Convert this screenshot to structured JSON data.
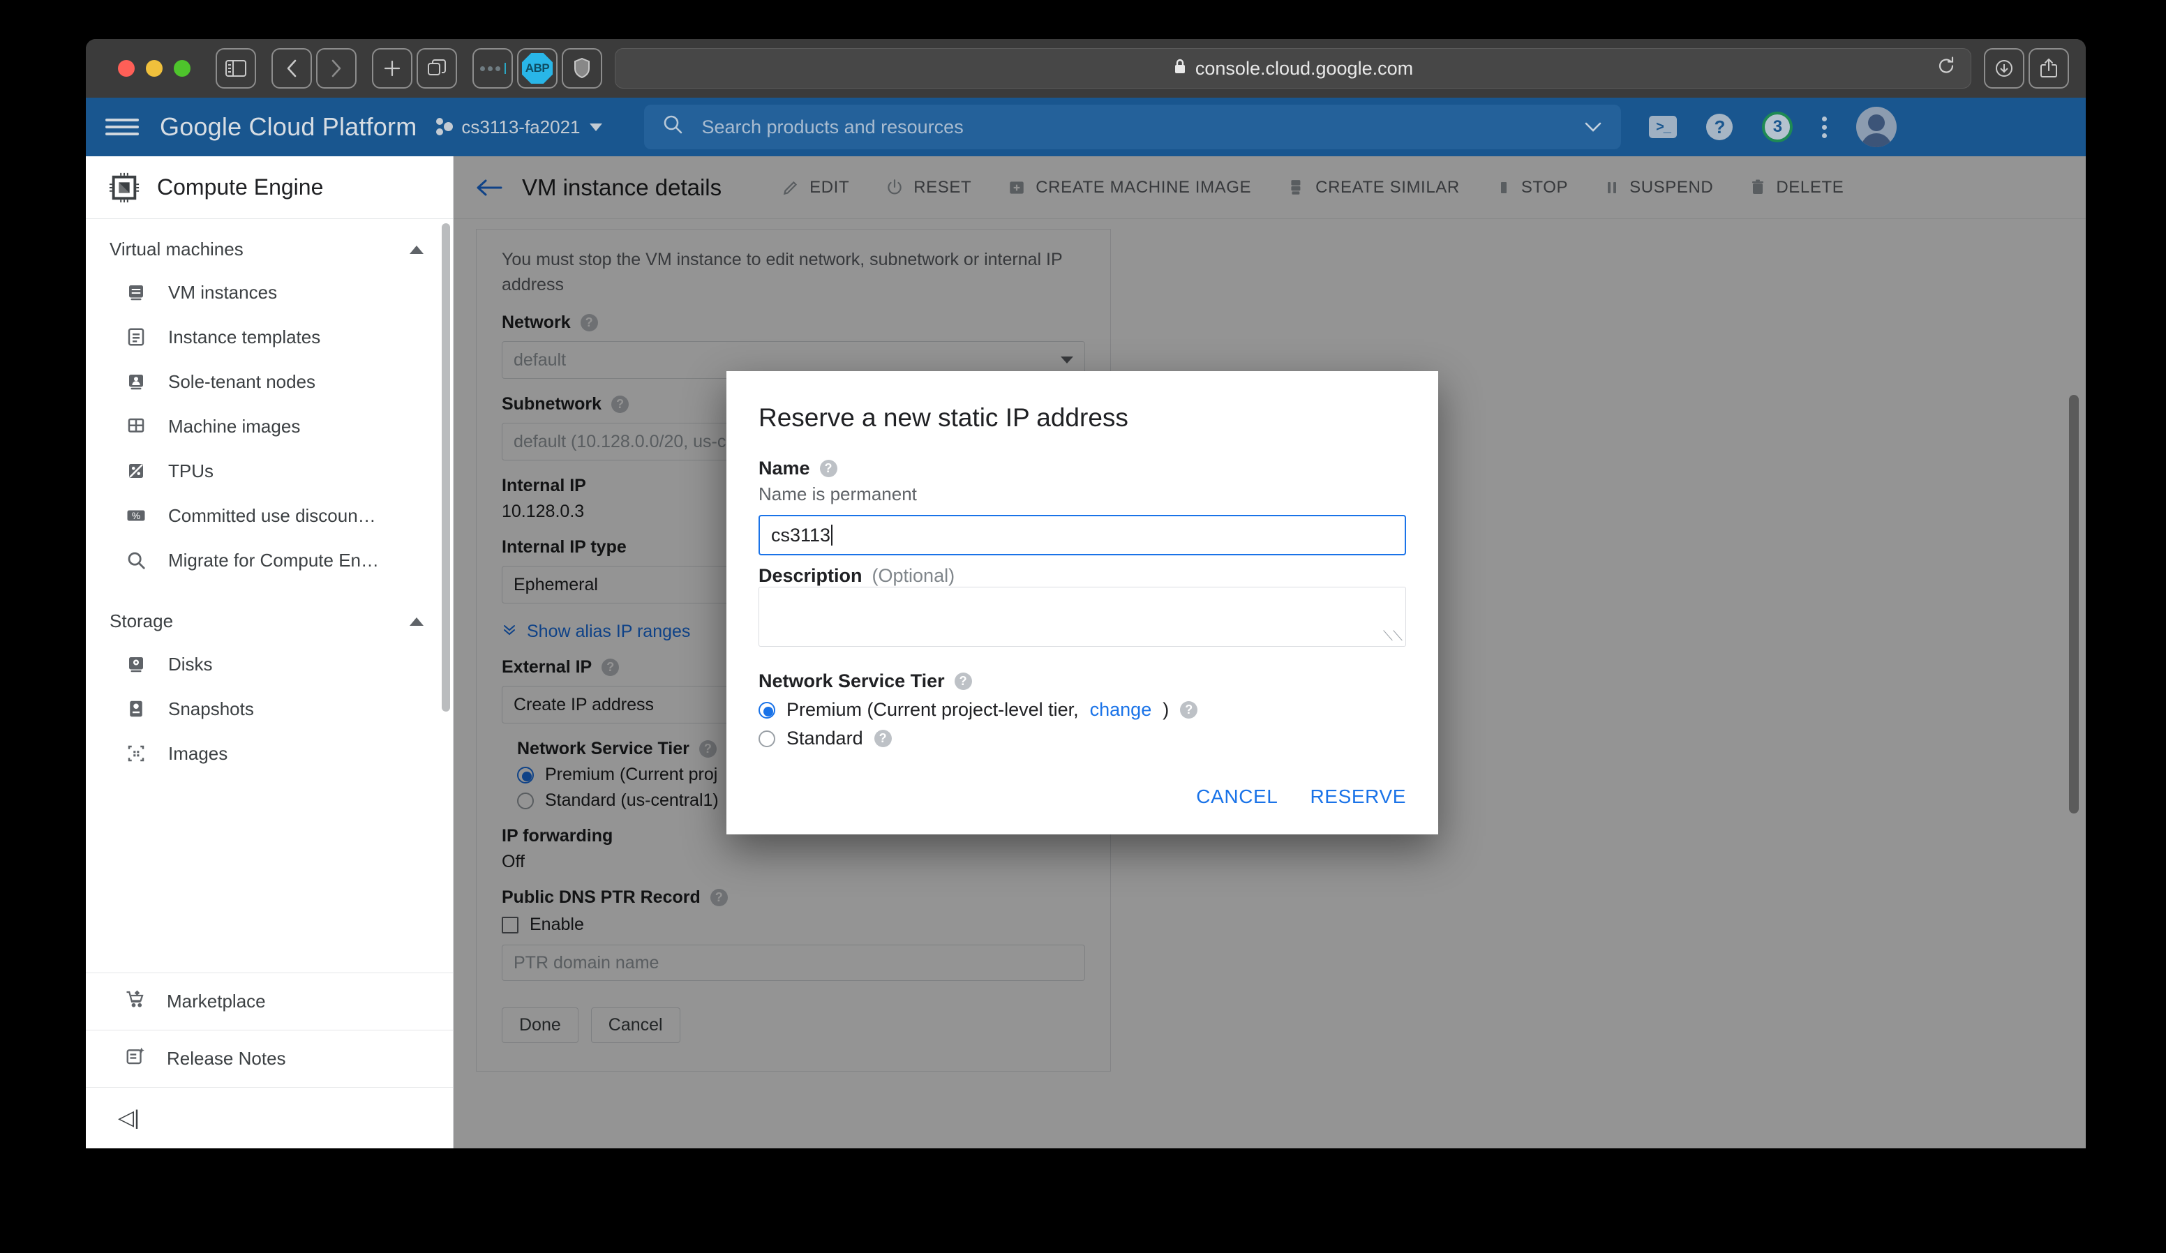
{
  "browser": {
    "url": "console.cloud.google.com",
    "lock_icon": "lock-icon",
    "reload_icon": "reload-icon",
    "traffic_lights": [
      "close",
      "minimize",
      "zoom"
    ],
    "toolbar_icons": [
      "sidebar-icon",
      "back-icon",
      "forward-icon",
      "new-tab-icon",
      "tab-overview-icon"
    ],
    "extensions": [
      {
        "name": "dots-extension-icon",
        "label": ""
      },
      {
        "name": "adblock-plus-icon",
        "label": "ABP"
      },
      {
        "name": "shield-extension-icon",
        "label": ""
      }
    ],
    "right_icons": [
      "downloads-icon",
      "share-icon"
    ]
  },
  "header": {
    "menu_icon": "hamburger-icon",
    "brand": "Google Cloud Platform",
    "project": "cs3113-fa2021",
    "project_icon": "project-dots-icon",
    "project_caret": "chevron-down-icon",
    "search_placeholder": "Search products and resources",
    "search_icon": "search-icon",
    "search_caret": "chevron-down-icon",
    "cloud_shell_icon": "cloud-shell-icon",
    "cloud_shell_glyph": ">_",
    "help_icon": "help-icon",
    "help_glyph": "?",
    "notification_count": "3",
    "kebab_icon": "more-vert-icon",
    "avatar_icon": "avatar-icon"
  },
  "sidebar": {
    "product_icon": "compute-engine-icon",
    "product_title": "Compute Engine",
    "groups": [
      {
        "label": "Virtual machines",
        "collapse_icon": "chevron-up-icon",
        "items": [
          {
            "label": "VM instances",
            "icon": "vm-instances-icon"
          },
          {
            "label": "Instance templates",
            "icon": "instance-templates-icon"
          },
          {
            "label": "Sole-tenant nodes",
            "icon": "sole-tenant-nodes-icon"
          },
          {
            "label": "Machine images",
            "icon": "machine-images-icon"
          },
          {
            "label": "TPUs",
            "icon": "tpu-icon"
          },
          {
            "label": "Committed use discoun…",
            "icon": "percent-icon"
          },
          {
            "label": "Migrate for Compute En…",
            "icon": "search-icon"
          }
        ]
      },
      {
        "label": "Storage",
        "collapse_icon": "chevron-up-icon",
        "items": [
          {
            "label": "Disks",
            "icon": "disk-icon"
          },
          {
            "label": "Snapshots",
            "icon": "snapshot-icon"
          },
          {
            "label": "Images",
            "icon": "images-icon"
          }
        ]
      }
    ],
    "bottom_items": [
      {
        "label": "Marketplace",
        "icon": "marketplace-cart-icon"
      },
      {
        "label": "Release Notes",
        "icon": "release-notes-icon"
      }
    ],
    "collapse_label": "◁|"
  },
  "toolbar": {
    "back_icon": "back-arrow-icon",
    "title": "VM instance details",
    "actions": [
      {
        "label": "EDIT",
        "icon": "pencil-icon"
      },
      {
        "label": "RESET",
        "icon": "power-reset-icon"
      },
      {
        "label": "CREATE MACHINE IMAGE",
        "icon": "plus-square-icon"
      },
      {
        "label": "CREATE SIMILAR",
        "icon": "copy-instance-icon"
      },
      {
        "label": "STOP",
        "icon": "stop-square-icon"
      },
      {
        "label": "SUSPEND",
        "icon": "pause-icon"
      },
      {
        "label": "DELETE",
        "icon": "trash-icon"
      }
    ]
  },
  "form": {
    "warning": "You must stop the VM instance to edit network, subnetwork or internal IP address",
    "network_label": "Network",
    "network_value": "default",
    "subnetwork_label": "Subnetwork",
    "subnetwork_value": "default (10.128.0.0/20, us-c",
    "internal_ip_label": "Internal IP",
    "internal_ip_value": "10.128.0.3",
    "internal_ip_type_label": "Internal IP type",
    "internal_ip_type_value": "Ephemeral",
    "alias_link": "Show alias IP ranges",
    "alias_icon": "double-chevron-down-icon",
    "external_ip_label": "External IP",
    "external_ip_value": "Create IP address",
    "tier_label": "Network Service Tier",
    "tier_premium": "Premium (Current proj",
    "tier_standard": "Standard (us-central1)",
    "ip_forwarding_label": "IP forwarding",
    "ip_forwarding_value": "Off",
    "ptr_label": "Public DNS PTR Record",
    "ptr_enable_label": "Enable",
    "ptr_placeholder": "PTR domain name",
    "done_label": "Done",
    "cancel_label": "Cancel",
    "help_glyph": "?"
  },
  "dialog": {
    "title": "Reserve a new static IP address",
    "name_label": "Name",
    "name_hint": "Name is permanent",
    "name_value": "cs3113",
    "description_label": "Description",
    "description_optional": "(Optional)",
    "description_value": "",
    "tier_label": "Network Service Tier",
    "tier_options": [
      {
        "label_before": "Premium (Current project-level tier, ",
        "link": "change",
        "label_after": ")",
        "selected": true
      },
      {
        "label_before": "Standard",
        "link": "",
        "label_after": "",
        "selected": false
      }
    ],
    "cancel_label": "CANCEL",
    "reserve_label": "RESERVE",
    "help_glyph": "?"
  },
  "colors": {
    "accent_blue": "#1a73e8",
    "header_blue": "#19568f",
    "abp_cyan": "#29b6e8",
    "notif_green": "#1e8a54"
  }
}
